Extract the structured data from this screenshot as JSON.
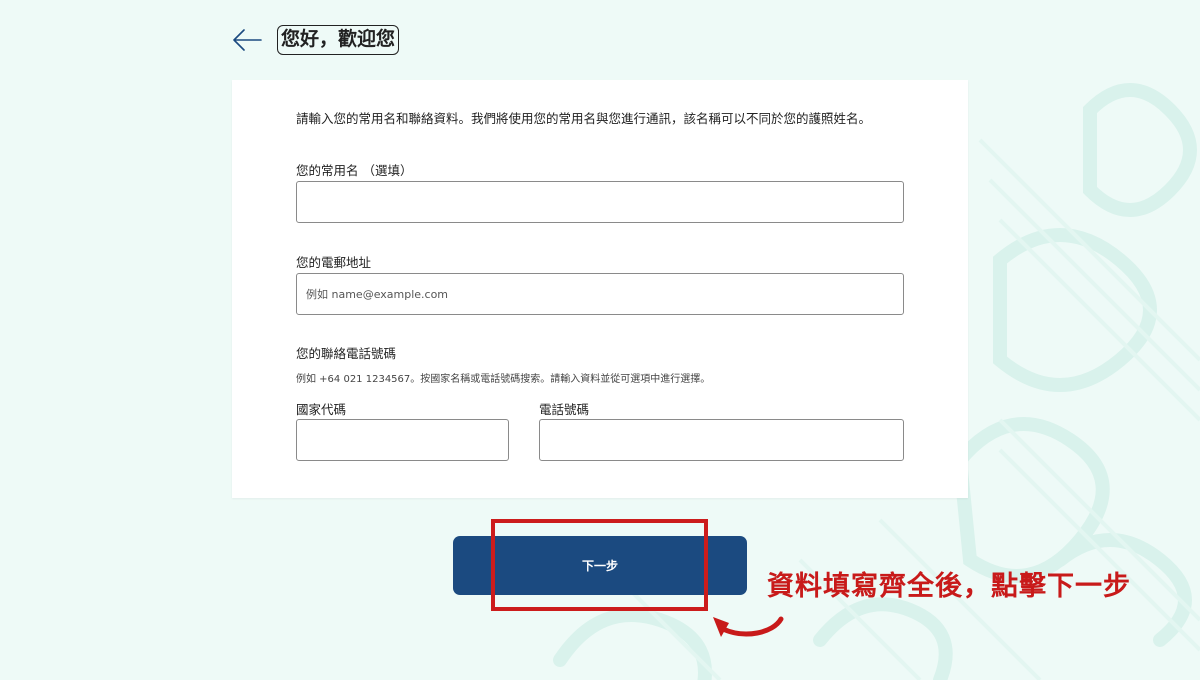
{
  "header": {
    "back_icon": "arrow-left-icon",
    "title": "您好，歡迎您"
  },
  "form": {
    "intro": "請輸入您的常用名和聯絡資料。我們將使用您的常用名與您進行通訊，該名稱可以不同於您的護照姓名。",
    "preferred_name": {
      "label": "您的常用名 （選填）",
      "value": "",
      "placeholder": ""
    },
    "email": {
      "label": "您的電郵地址",
      "value": "",
      "placeholder": "例如 name@example.com"
    },
    "phone": {
      "label": "您的聯絡電話號碼",
      "hint": "例如 +64 021 1234567。按國家名稱或電話號碼搜索。請輸入資料並從可選項中進行選擇。",
      "country_code_label": "國家代碼",
      "country_code_value": "",
      "number_label": "電話號碼",
      "number_value": ""
    }
  },
  "actions": {
    "next_label": "下一步"
  },
  "annotation": {
    "text": "資料填寫齊全後，點擊下一步",
    "color": "#c81a1a",
    "arrow_icon": "curved-arrow-icon"
  },
  "colors": {
    "primary": "#1b4a80",
    "background": "#eefaf7",
    "highlight": "#cc1c1c"
  }
}
